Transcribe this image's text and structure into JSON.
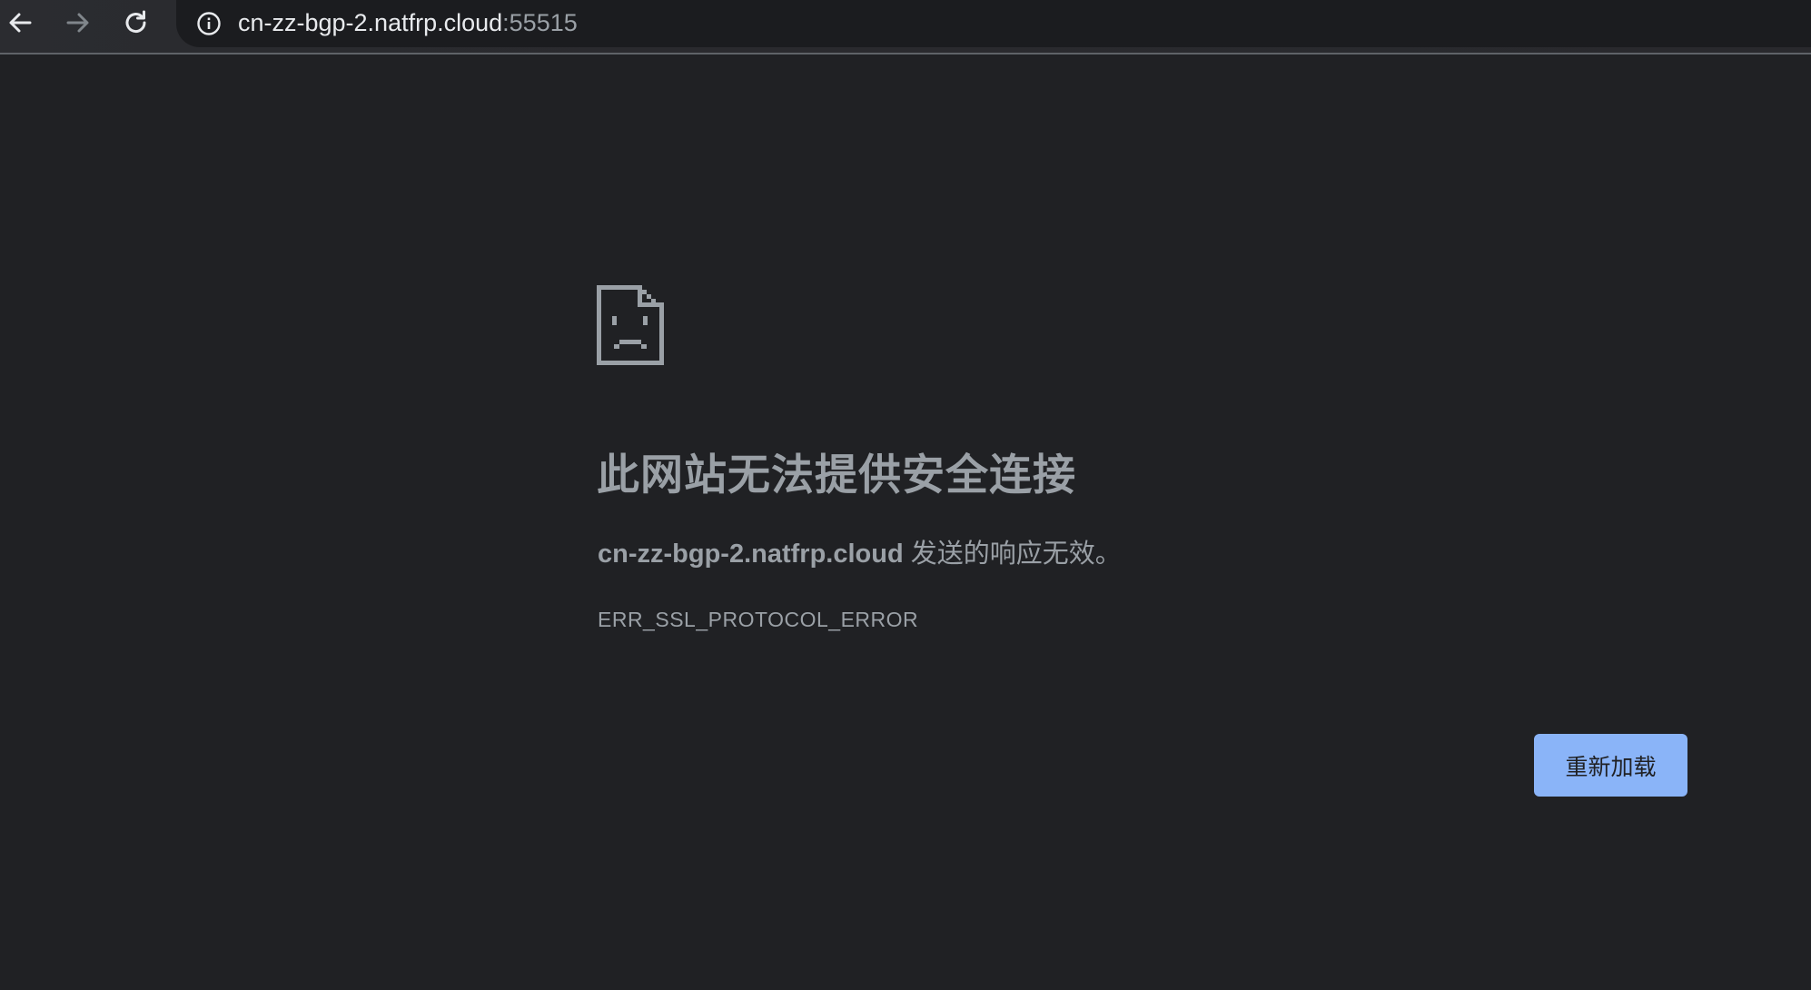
{
  "browser": {
    "url_host": "cn-zz-bgp-2.natfrp.cloud",
    "url_port": ":55515",
    "icons": {
      "back": "arrow-left-icon",
      "forward": "arrow-right-icon",
      "reload": "reload-icon",
      "site_info": "info-icon"
    }
  },
  "error_page": {
    "icon": "sad-document-icon",
    "headline": "此网站无法提供安全连接",
    "description_host": "cn-zz-bgp-2.natfrp.cloud",
    "description_text": " 发送的响应无效。",
    "error_code": "ERR_SSL_PROTOCOL_ERROR",
    "reload_button_label": "重新加载"
  },
  "colors": {
    "background": "#202124",
    "text_secondary": "#9aa0a6",
    "url_text": "#e8eaed",
    "button_accent": "#8ab4f8"
  }
}
